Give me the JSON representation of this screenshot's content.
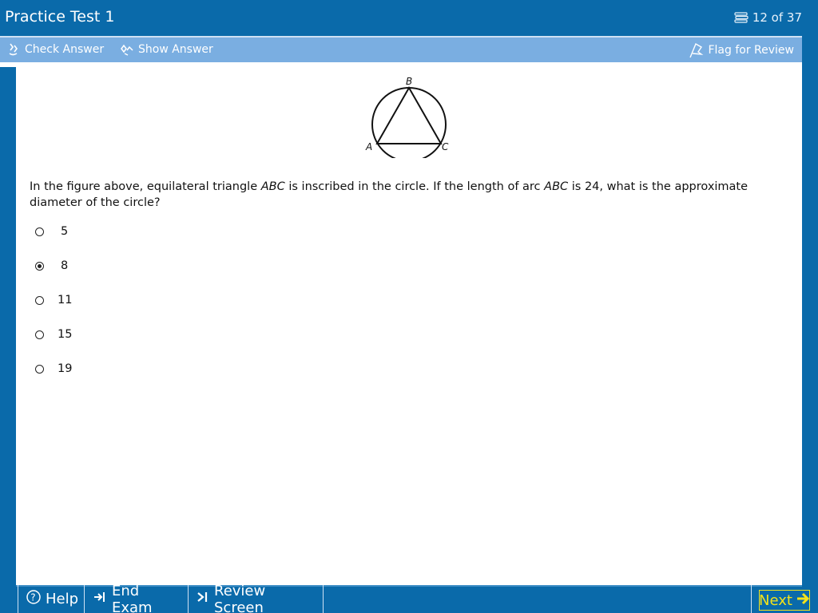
{
  "header": {
    "title": "Practice Test 1",
    "counter": "12 of 37"
  },
  "toolbar": {
    "check_answer": "Check Answer",
    "show_answer": "Show Answer",
    "flag_for_review": "Flag for Review"
  },
  "question": {
    "figure_labels": {
      "a": "A",
      "b": "B",
      "c": "C"
    },
    "text_parts": [
      "In the figure above, equilateral triangle ",
      "ABC",
      " is inscribed in the circle.  If the length of arc ",
      "ABC",
      " is 24, what is the approximate diameter of the circle?"
    ],
    "choices": [
      {
        "label": "5",
        "selected": false
      },
      {
        "label": "8",
        "selected": true
      },
      {
        "label": "11",
        "selected": false
      },
      {
        "label": "15",
        "selected": false
      },
      {
        "label": "19",
        "selected": false
      }
    ]
  },
  "footer": {
    "help": "Help",
    "end_exam": "End Exam",
    "review_screen": "Review Screen",
    "next": "Next"
  },
  "colors": {
    "frame": "#0a6aaa",
    "toolbar": "#7aaee1",
    "next_accent": "#f4e21a"
  }
}
